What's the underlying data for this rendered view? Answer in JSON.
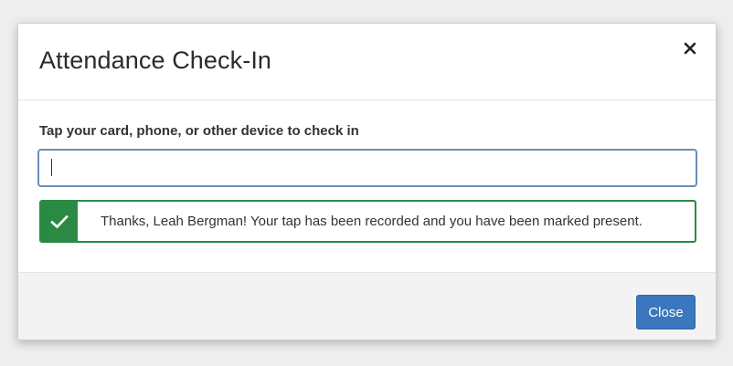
{
  "modal": {
    "title": "Attendance Check-In",
    "close_icon": "close-icon"
  },
  "form": {
    "label": "Tap your card, phone, or other device to check in",
    "input_value": "",
    "input_placeholder": ""
  },
  "alert": {
    "icon": "checkmark-icon",
    "message": "Thanks, Leah Bergman! Your tap has been recorded and you have been marked present.",
    "color": "#2a8a43"
  },
  "footer": {
    "close_label": "Close",
    "button_color": "#3a77bd"
  }
}
